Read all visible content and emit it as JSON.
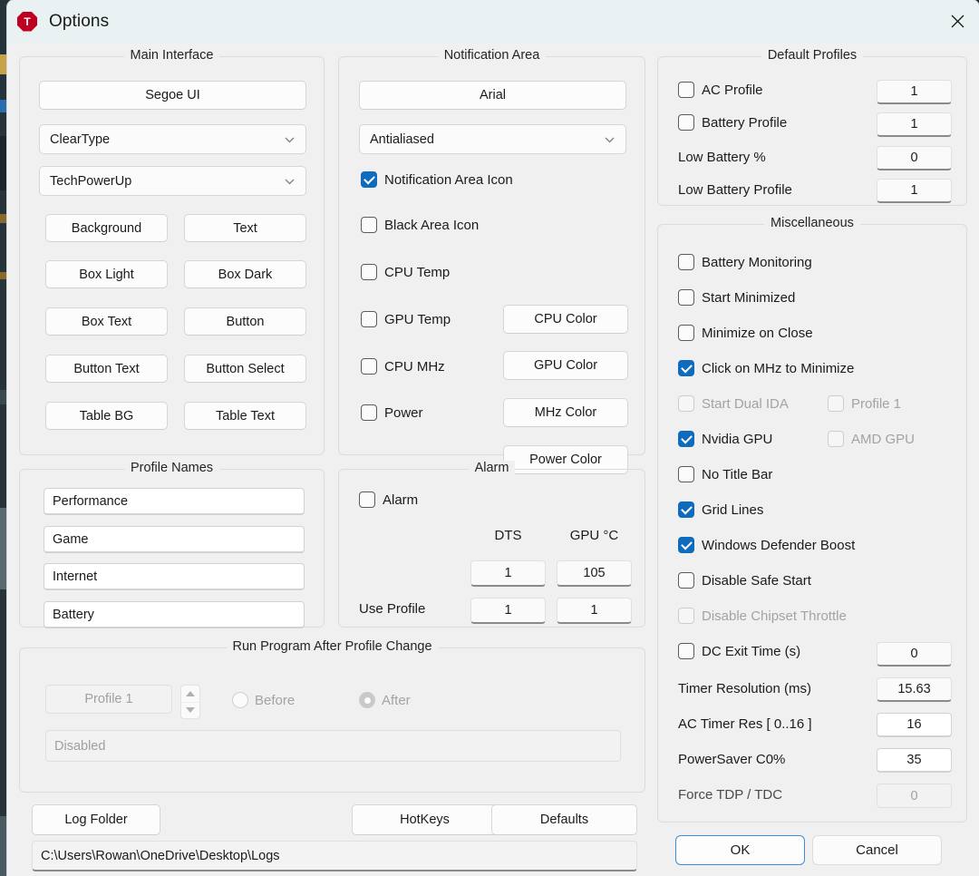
{
  "window": {
    "title": "Options",
    "app_icon_letter": "T",
    "close_icon": "close-icon",
    "accent_color": "#0f6cbd",
    "app_icon_color": "#c00020"
  },
  "main_interface": {
    "legend": "Main Interface",
    "font_button": "Segoe UI",
    "rendering_combo": "ClearType",
    "theme_combo": "TechPowerUp",
    "color_buttons": [
      "Background",
      "Text",
      "Box Light",
      "Box Dark",
      "Box Text",
      "Button",
      "Button Text",
      "Button Select",
      "Table BG",
      "Table Text"
    ]
  },
  "profile_names": {
    "legend": "Profile Names",
    "values": [
      "Performance",
      "Game",
      "Internet",
      "Battery"
    ]
  },
  "notification_area": {
    "legend": "Notification Area",
    "font_button": "Arial",
    "rendering_combo": "Antialiased",
    "checkboxes": [
      {
        "label": "Notification Area Icon",
        "checked": true
      },
      {
        "label": "Black Area Icon",
        "checked": false
      }
    ],
    "rows": [
      {
        "label": "CPU Temp",
        "checked": false,
        "button": "CPU Color"
      },
      {
        "label": "GPU Temp",
        "checked": false,
        "button": "GPU Color"
      },
      {
        "label": "CPU MHz",
        "checked": false,
        "button": "MHz Color"
      },
      {
        "label": "Power",
        "checked": false,
        "button": "Power Color"
      }
    ]
  },
  "alarm": {
    "legend": "Alarm",
    "enable_label": "Alarm",
    "enabled": false,
    "col_dts": "DTS",
    "col_gpu": "GPU °C",
    "threshold_dts": "1",
    "threshold_gpu": "105",
    "use_profile_label": "Use Profile",
    "use_profile_dts": "1",
    "use_profile_gpu": "1"
  },
  "run_program": {
    "legend": "Run Program After Profile Change",
    "profile_value": "Profile 1",
    "radio_before": "Before",
    "radio_after": "After",
    "selected_radio": "After",
    "path_value": "Disabled"
  },
  "bottom": {
    "log_folder_button": "Log Folder",
    "hotkeys_button": "HotKeys",
    "defaults_button": "Defaults",
    "log_path": "C:\\Users\\Rowan\\OneDrive\\Desktop\\Logs"
  },
  "default_profiles": {
    "legend": "Default Profiles",
    "rows": [
      {
        "label": "AC Profile",
        "type": "checkbox",
        "checked": false,
        "value": "1"
      },
      {
        "label": "Battery Profile",
        "type": "checkbox",
        "checked": false,
        "value": "1"
      },
      {
        "label": "Low Battery %",
        "type": "label",
        "value": "0"
      },
      {
        "label": "Low Battery Profile",
        "type": "label",
        "value": "1"
      }
    ]
  },
  "miscellaneous": {
    "legend": "Miscellaneous",
    "checkboxes": [
      {
        "label": "Battery Monitoring",
        "checked": false,
        "disabled": false
      },
      {
        "label": "Start Minimized",
        "checked": false,
        "disabled": false
      },
      {
        "label": "Minimize on Close",
        "checked": false,
        "disabled": false
      },
      {
        "label": "Click on MHz to Minimize",
        "checked": true,
        "disabled": false
      },
      {
        "label": "Start Dual IDA",
        "checked": false,
        "disabled": true
      },
      {
        "label": "Profile 1",
        "checked": false,
        "disabled": true
      },
      {
        "label": "Nvidia GPU",
        "checked": true,
        "disabled": false
      },
      {
        "label": "AMD GPU",
        "checked": false,
        "disabled": true
      },
      {
        "label": "No Title Bar",
        "checked": false,
        "disabled": false
      },
      {
        "label": "Grid Lines",
        "checked": true,
        "disabled": false
      },
      {
        "label": "Windows Defender Boost",
        "checked": true,
        "disabled": false
      },
      {
        "label": "Disable Safe Start",
        "checked": false,
        "disabled": false
      },
      {
        "label": "Disable Chipset Throttle",
        "checked": false,
        "disabled": true
      },
      {
        "label": "DC Exit Time (s)",
        "checked": false,
        "disabled": false
      }
    ],
    "dc_exit_time_value": "0",
    "numeric_rows": [
      {
        "label": "Timer Resolution (ms)",
        "value": "15.63",
        "editable": false,
        "disabled": false
      },
      {
        "label": "AC Timer Res [ 0..16 ]",
        "value": "16",
        "editable": true,
        "disabled": false
      },
      {
        "label": "PowerSaver C0%",
        "value": "35",
        "editable": true,
        "disabled": false
      },
      {
        "label": "Force TDP / TDC",
        "value": "0",
        "editable": false,
        "disabled": true
      }
    ]
  },
  "dialog_buttons": {
    "ok": "OK",
    "cancel": "Cancel"
  }
}
